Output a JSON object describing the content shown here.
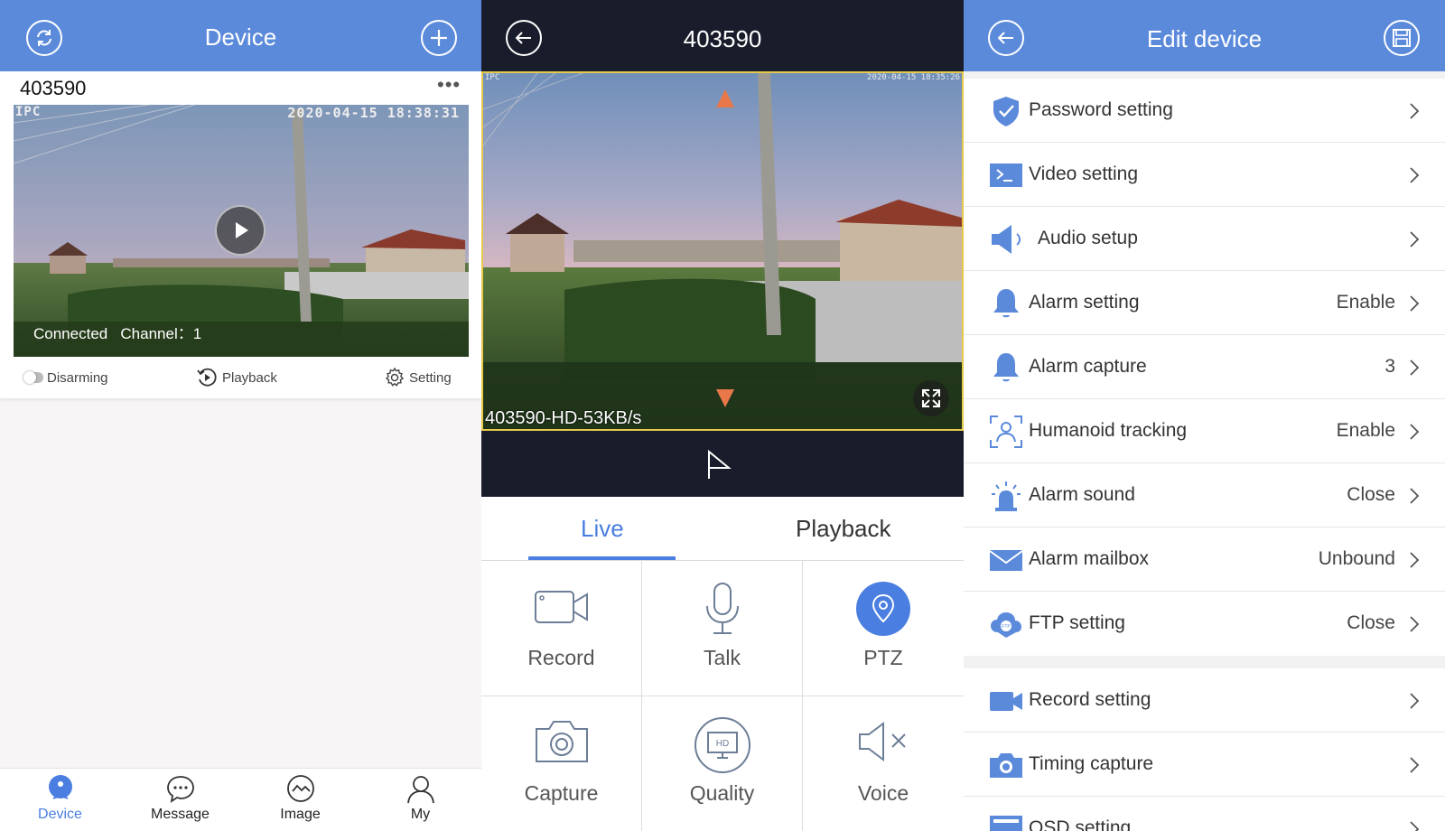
{
  "device_list": {
    "header": {
      "title": "Device"
    },
    "card": {
      "name": "403590",
      "more": "•••",
      "osd_left": "IPC",
      "osd_datetime": "2020-04-15 18:38:31",
      "status": "Connected",
      "channel": "Channel：1",
      "actions": {
        "disarming": "Disarming",
        "playback": "Playback",
        "setting": "Setting"
      }
    },
    "tabbar": [
      {
        "label": "Device",
        "icon": "device-icon",
        "active": true
      },
      {
        "label": "Message",
        "icon": "message-icon",
        "active": false
      },
      {
        "label": "Image",
        "icon": "image-icon",
        "active": false
      },
      {
        "label": "My",
        "icon": "user-icon",
        "active": false
      }
    ],
    "colors": {
      "brand": "#5b8adb",
      "active": "#4a7ee0"
    }
  },
  "live_view": {
    "header": {
      "title": "403590"
    },
    "video": {
      "osd_left": "IPC",
      "osd_datetime": "2020-04-15 18:35:26",
      "caption": "403590-HD-53KB/s"
    },
    "tabs": {
      "live": "Live",
      "playback": "Playback",
      "active": "live"
    },
    "controls": [
      {
        "label": "Record",
        "icon": "video-camera-icon"
      },
      {
        "label": "Talk",
        "icon": "microphone-icon"
      },
      {
        "label": "PTZ",
        "icon": "location-pin-icon"
      },
      {
        "label": "Capture",
        "icon": "camera-icon"
      },
      {
        "label": "Quality",
        "icon": "hd-monitor-icon"
      },
      {
        "label": "Voice",
        "icon": "speaker-mute-icon"
      }
    ],
    "colors": {
      "header_bg": "#191c2b",
      "ptz_arrow": "#e8784a",
      "accent": "#4a7ee0"
    }
  },
  "edit_device": {
    "header": {
      "title": "Edit device"
    },
    "rows": [
      {
        "label": "Password setting",
        "value": "",
        "icon": "shield-check-icon"
      },
      {
        "label": "Video setting",
        "value": "",
        "icon": "terminal-icon"
      },
      {
        "label": "Audio setup",
        "value": "",
        "icon": "speaker-icon"
      },
      {
        "label": "Alarm setting",
        "value": "Enable",
        "icon": "bell-icon"
      },
      {
        "label": "Alarm capture",
        "value": "3",
        "icon": "bell-icon"
      },
      {
        "label": "Humanoid tracking",
        "value": "Enable",
        "icon": "person-frame-icon"
      },
      {
        "label": "Alarm sound",
        "value": "Close",
        "icon": "siren-icon"
      },
      {
        "label": "Alarm mailbox",
        "value": "Unbound",
        "icon": "envelope-icon"
      },
      {
        "label": "FTP setting",
        "value": "Close",
        "icon": "ftp-cloud-icon"
      },
      {
        "label": "Record setting",
        "value": "",
        "icon": "video-camera-icon"
      },
      {
        "label": "Timing capture",
        "value": "",
        "icon": "camera-icon"
      },
      {
        "label": "OSD setting",
        "value": "",
        "icon": "osd-icon"
      }
    ],
    "colors": {
      "icon": "#5b8adb"
    }
  }
}
